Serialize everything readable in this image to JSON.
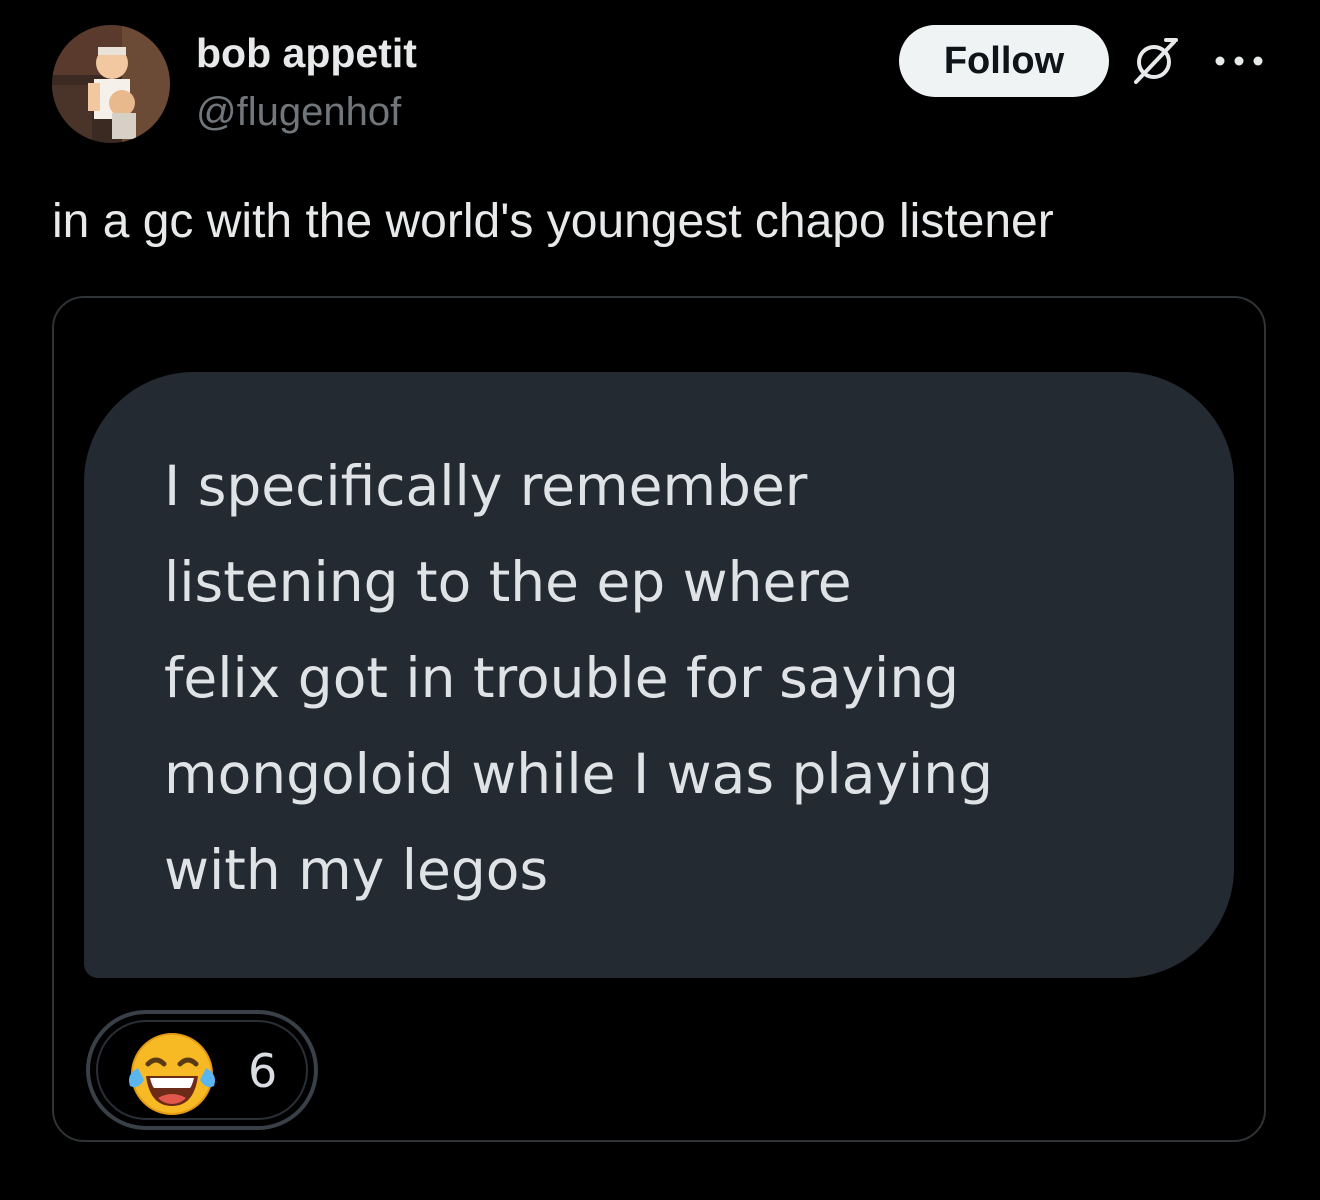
{
  "author": {
    "display_name": "bob appetit",
    "handle": "@flugenhof",
    "avatar_icon": "avatar-cartoon-icon"
  },
  "header_actions": {
    "follow_label": "Follow",
    "grok_icon": "grok-icon",
    "more_icon": "more-options-icon"
  },
  "tweet": {
    "text": "in a gc with the world's youngest chapo listener"
  },
  "media": {
    "message_text": "I specifically remember\nlistening to the ep where\nfelix got in trouble for saying\nmongoloid while I was playing\nwith my legos",
    "reaction": {
      "emoji_icon": "face-with-tears-of-joy-icon",
      "count": "6"
    }
  },
  "colors": {
    "background": "#000000",
    "text_primary": "#e7e9ea",
    "text_secondary": "#71767b",
    "follow_button_bg": "#eff3f4",
    "bubble_bg": "#242a31",
    "card_border": "#2f3336"
  }
}
